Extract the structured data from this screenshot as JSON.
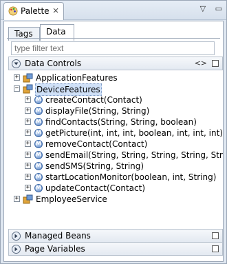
{
  "view": {
    "title": "Palette",
    "close": "⨯",
    "menu_btn": "▽",
    "min_btn": "▭"
  },
  "tabs": [
    {
      "label": "Tags"
    },
    {
      "label": "Data"
    }
  ],
  "filter": {
    "placeholder": "type filter text"
  },
  "sections": {
    "data_controls": {
      "label": "Data Controls",
      "btn": "<>"
    },
    "managed_beans": {
      "label": "Managed Beans"
    },
    "page_variables": {
      "label": "Page Variables"
    }
  },
  "tree": {
    "application_features": {
      "label": "ApplicationFeatures",
      "expander": "+"
    },
    "device_features": {
      "label": "DeviceFeatures",
      "expander": "−"
    },
    "methods": [
      {
        "label": "createContact(Contact)",
        "expander": "+"
      },
      {
        "label": "displayFile(String, String)",
        "expander": "+"
      },
      {
        "label": "findContacts(String, String, boolean)",
        "expander": "+"
      },
      {
        "label": "getPicture(int, int, int, boolean, int, int, int)",
        "expander": "+"
      },
      {
        "label": "removeContact(Contact)",
        "expander": "+"
      },
      {
        "label": "sendEmail(String, String, String, String, Strin",
        "expander": "+"
      },
      {
        "label": "sendSMS(String, String)",
        "expander": "+"
      },
      {
        "label": "startLocationMonitor(boolean, int, String)",
        "expander": "+"
      },
      {
        "label": "updateContact(Contact)",
        "expander": "+"
      }
    ],
    "employee_service": {
      "label": "EmployeeService",
      "expander": "+"
    }
  },
  "method_icon_letter": "M",
  "colors": {
    "frame_bg": "#dfe7f1",
    "selection": "#cfe0f7",
    "method_icon": "#5b86c4",
    "package_icon": "#e0a43a"
  }
}
